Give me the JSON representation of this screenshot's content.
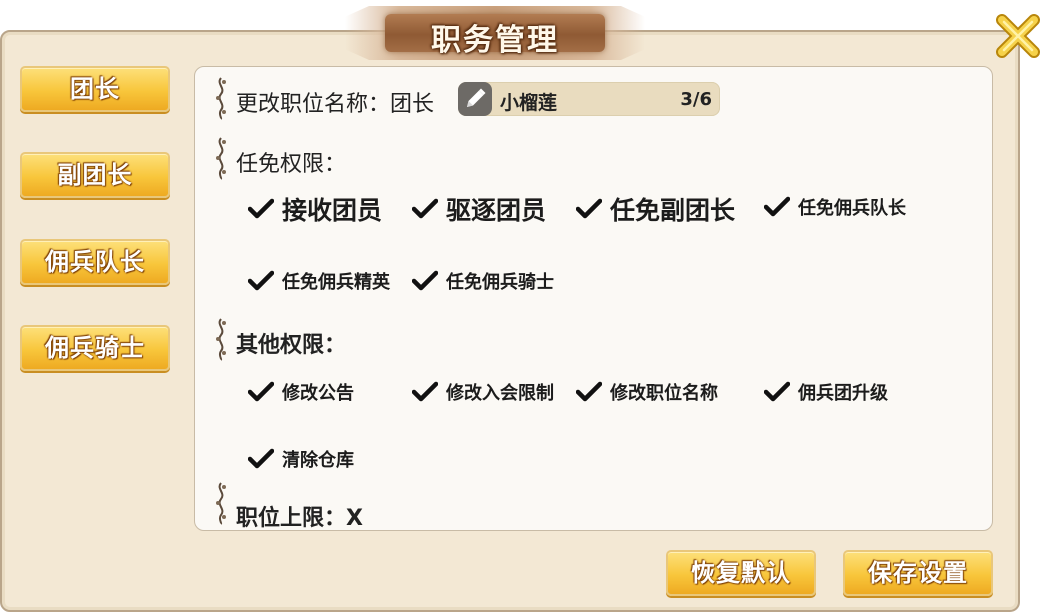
{
  "title": "职务管理",
  "tabs": [
    {
      "label": "团长"
    },
    {
      "label": "副团长"
    },
    {
      "label": "佣兵队长"
    },
    {
      "label": "佣兵骑士"
    }
  ],
  "rename": {
    "label": "更改职位名称：团长",
    "value": "小榴莲",
    "count": "3/6"
  },
  "appoint": {
    "label": "任免权限：",
    "items": [
      {
        "label": "接收团员",
        "checked": true
      },
      {
        "label": "驱逐团员",
        "checked": true
      },
      {
        "label": "任免副团长",
        "checked": true
      },
      {
        "label": "任免佣兵队长",
        "checked": true
      },
      {
        "label": "任免佣兵精英",
        "checked": true
      },
      {
        "label": "任免佣兵骑士",
        "checked": true
      }
    ]
  },
  "other": {
    "label": "其他权限：",
    "items": [
      {
        "label": "修改公告",
        "checked": true
      },
      {
        "label": "修改入会限制",
        "checked": true
      },
      {
        "label": "修改职位名称",
        "checked": true
      },
      {
        "label": "佣兵团升级",
        "checked": true
      },
      {
        "label": "清除仓库",
        "checked": true
      }
    ]
  },
  "limit": {
    "label": "职位上限：X"
  },
  "buttons": {
    "restore": "恢复默认",
    "save": "保存设置"
  },
  "icons": {
    "close": "close-icon",
    "edit": "pencil-icon",
    "check": "checkmark-icon",
    "vine": "vine-ornament-icon"
  },
  "colors": {
    "dialog_bg": "#f3e8d4",
    "panel_bg": "#fbf9f5",
    "button_gold": "#f8c63b",
    "title_brown": "#8f5a34",
    "name_field_bg": "#e9dcbf",
    "close_gold": "#f2c53a"
  }
}
